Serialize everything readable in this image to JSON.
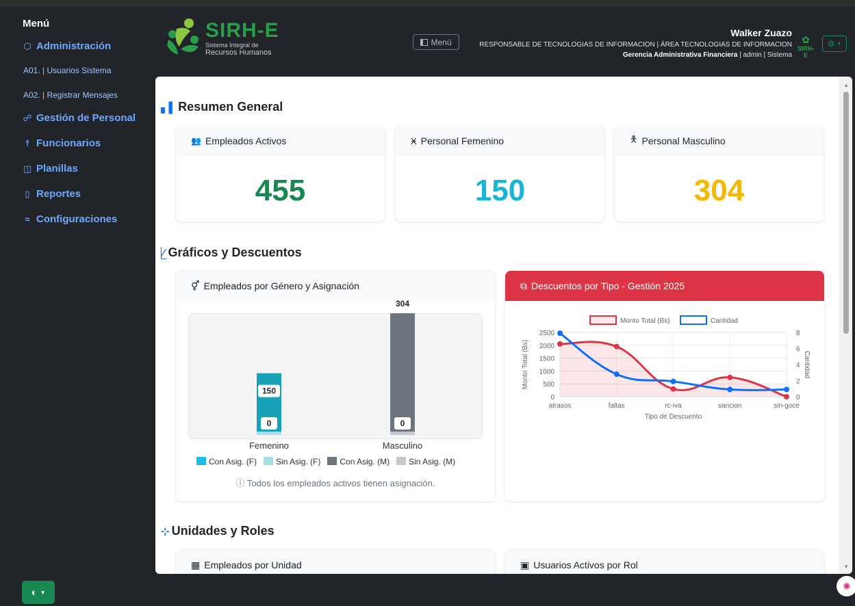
{
  "sidebar": {
    "title": "Menú",
    "items": [
      {
        "label": "Administración",
        "icon": "box-icon"
      },
      {
        "label": "Gestión de Personal",
        "icon": "people-icon"
      },
      {
        "label": "Funcionarios",
        "icon": "person-icon"
      },
      {
        "label": "Planillas",
        "icon": "book-icon"
      },
      {
        "label": "Reportes",
        "icon": "file-icon"
      },
      {
        "label": "Configuraciones",
        "icon": "sliders-icon"
      }
    ],
    "subitems": [
      "A01. | Usuarios Sistema",
      "A02. | Registrar Mensajes"
    ],
    "theme_button": "◐"
  },
  "header": {
    "logo_title": "SIRH-E",
    "logo_sub1": "Sistema Integral de",
    "logo_sub2": "Recursos Humanos",
    "menu_button": "Menú",
    "user_name": "Walker Zuazo",
    "user_role": "RESPONSABLE DE TECNOLOGIAS DE INFORMACION | ÁREA TECNOLOGIAS DE INFORMACION",
    "user_dept": "Gerencia Administrativa Financiera",
    "user_meta": "| admin | Sistema",
    "mini_logo": "SIRH-E"
  },
  "main": {
    "section1": "Resumen General",
    "section2": "Gráficos y Descuentos",
    "section3": "Unidades y Roles",
    "stats": [
      {
        "label": "Empleados Activos",
        "value": "455",
        "color": "#198754"
      },
      {
        "label": "Personal Femenino",
        "value": "150",
        "color": "#0dcaf0"
      },
      {
        "label": "Personal Masculino",
        "value": "304",
        "color": "#ffc107"
      }
    ],
    "gender_card_title": "Empleados por Género y Asignación",
    "discount_card_title": "Descuentos por Tipo - Gestión 2025",
    "note": "Todos los empleados activos tienen asignación.",
    "bottom_cards": [
      "Empleados por Unidad",
      "Usuarios Activos por Rol"
    ]
  },
  "chart_data": [
    {
      "type": "bar",
      "categories": [
        "Femenino",
        "Masculino"
      ],
      "series": [
        {
          "name": "Con Asig. (F)",
          "values": [
            150,
            0
          ],
          "color": "#17a2b8"
        },
        {
          "name": "Sin Asig. (F)",
          "values": [
            0,
            0
          ],
          "color": "#a8dde6"
        },
        {
          "name": "Con Asig. (M)",
          "values": [
            0,
            304
          ],
          "color": "#6c757d"
        },
        {
          "name": "Sin Asig. (M)",
          "values": [
            0,
            0
          ],
          "color": "#c4c8cc"
        }
      ],
      "data_labels": [
        {
          "category": "Femenino",
          "top": "150",
          "bottom": "0"
        },
        {
          "category": "Masculino",
          "top": "304",
          "bottom": "0"
        }
      ],
      "ylim": [
        0,
        304
      ]
    },
    {
      "type": "line",
      "title": "",
      "categories": [
        "atrasos",
        "faltas",
        "rc-iva",
        "sancion",
        "sin-goce"
      ],
      "xlabel": "Tipo de Descuento",
      "ylabel": "Monto Total (Bs)",
      "y2label": "Cantidad",
      "ylim": [
        0,
        2500
      ],
      "y2lim": [
        0,
        8
      ],
      "yticks": [
        "0",
        "500",
        "1000",
        "1500",
        "2000",
        "2500"
      ],
      "y2ticks": [
        "0",
        "2",
        "4",
        "6",
        "8"
      ],
      "series": [
        {
          "name": "Monto Total (Bs)",
          "values": [
            2050,
            1950,
            300,
            750,
            0
          ],
          "axis": "left",
          "color": "#dc3545",
          "fill": true
        },
        {
          "name": "Cantidad",
          "values": [
            7.9,
            2.8,
            1.9,
            0.9,
            0.9
          ],
          "axis": "right",
          "color": "#0d6efd",
          "fill": false
        }
      ],
      "legend": "top"
    }
  ]
}
